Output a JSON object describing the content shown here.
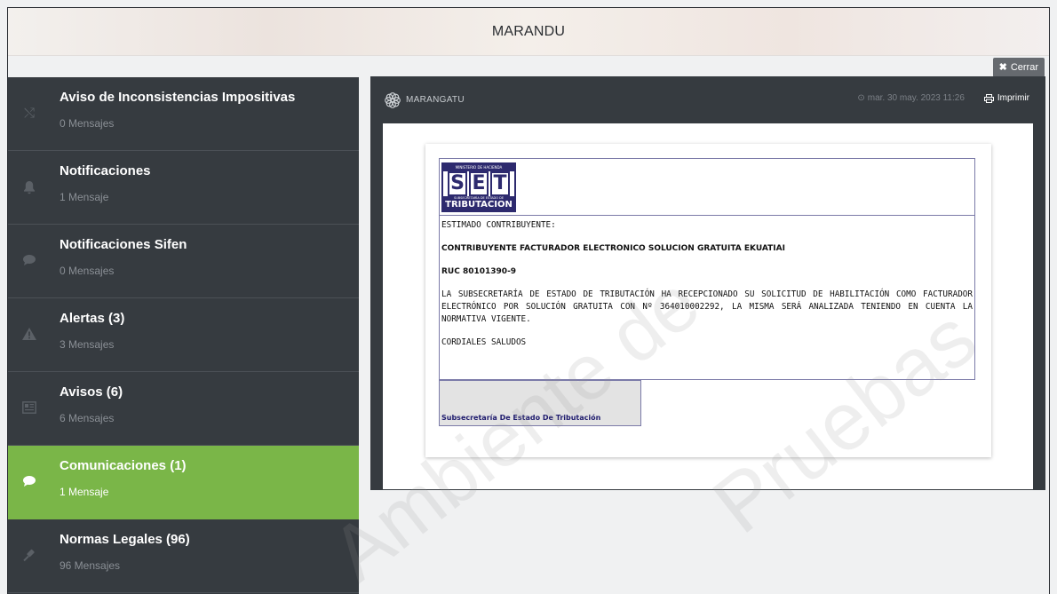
{
  "header": {
    "title": "MARANDU"
  },
  "close_button": {
    "label": "Cerrar",
    "icon": "close-icon"
  },
  "sidebar": {
    "items": [
      {
        "title": "Aviso de Inconsistencias Impositivas",
        "subtitle": "0 Mensajes",
        "icon": "shuffle-icon",
        "active": false
      },
      {
        "title": "Notificaciones",
        "subtitle": "1 Mensaje",
        "icon": "bell-icon",
        "active": false
      },
      {
        "title": "Notificaciones Sifen",
        "subtitle": "0 Mensajes",
        "icon": "comment-icon",
        "active": false
      },
      {
        "title": "Alertas (3)",
        "subtitle": "3 Mensajes",
        "icon": "warning-icon",
        "active": false
      },
      {
        "title": "Avisos (6)",
        "subtitle": "6 Mensajes",
        "icon": "newspaper-icon",
        "active": false
      },
      {
        "title": "Comunicaciones (1)",
        "subtitle": "1 Mensaje",
        "icon": "chat-icon",
        "active": true
      },
      {
        "title": "Normas Legales (96)",
        "subtitle": "96 Mensajes",
        "icon": "gavel-icon",
        "active": false
      }
    ]
  },
  "message": {
    "brand": "MARANGATU",
    "date": "mar. 30 may. 2023 11:26",
    "print_label": "Imprimir",
    "logo": {
      "top_text": "MINISTERIO DE HACIENDA",
      "letters": [
        "S",
        "E",
        "T"
      ],
      "sub_text": "SUBSECRETARÍA DE ESTADO DE",
      "bottom_text": "TRIBUTACION"
    },
    "greeting": "ESTIMADO CONTRIBUYENTE:",
    "subject": "CONTRIBUYENTE FACTURADOR ELECTRONICO SOLUCION GRATUITA EKUATIAI",
    "ruc": "RUC 80101390-9",
    "body": "LA SUBSECRETARÍA DE ESTADO DE TRIBUTACIÓN HA RECEPCIONADO SU SOLICITUD DE HABILITACIÓN COMO FACTURADOR ELECTRÓNICO POR SOLUCIÓN GRATUITA CON Nº 364010002292, LA MISMA SERÁ ANALIZADA TENIENDO EN CUENTA LA NORMATIVA VIGENTE.",
    "closing": "CORDIALES SALUDOS",
    "signature": "Subsecretaría De Estado De Tributación"
  },
  "watermark": {
    "line1": "Ambiente de",
    "line2": "Pruebas"
  },
  "colors": {
    "sidebar_bg": "#363b40",
    "active_bg": "#7ab648",
    "panel_bg": "#363b40",
    "logo_blue": "#2d2a6e"
  }
}
